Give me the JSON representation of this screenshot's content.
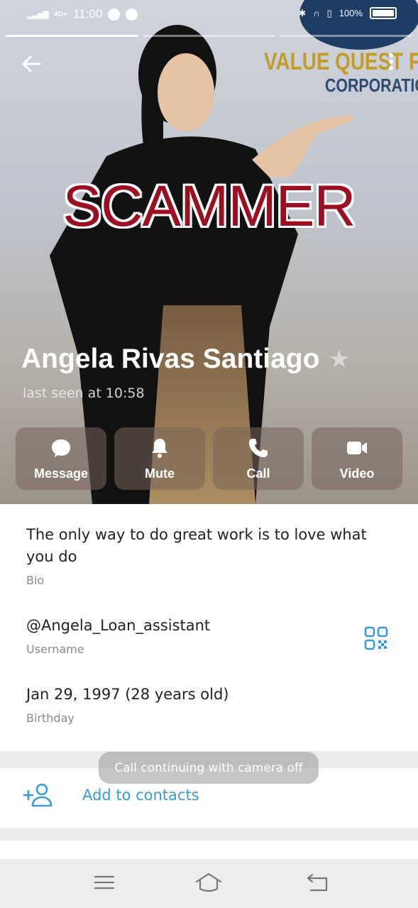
{
  "status_bar": {
    "network": "4G+",
    "time": "11:00",
    "battery": "100%"
  },
  "story_progress": {
    "segments": 3,
    "active": 1
  },
  "background_logo": {
    "line1": "VALUE QUEST FI",
    "line2": "CORPORATIO"
  },
  "overlay_text": "SCAMMER",
  "profile": {
    "name": "Angela Rivas Santiago",
    "last_seen": "last seen at 10:58"
  },
  "actions": [
    {
      "label": "Message",
      "icon": "message-icon"
    },
    {
      "label": "Mute",
      "icon": "bell-icon"
    },
    {
      "label": "Call",
      "icon": "phone-icon"
    },
    {
      "label": "Video",
      "icon": "video-icon"
    }
  ],
  "info": {
    "bio": "The only way to do great work is to love what you do",
    "bio_label": "Bio",
    "username": "@Angela_Loan_assistant",
    "username_label": "Username",
    "birthday": "Jan 29, 1997 (28 years old)",
    "birthday_label": "Birthday"
  },
  "toast": "Call continuing with camera off",
  "add_contacts": "Add to contacts",
  "colors": {
    "accent": "#3a9bd4",
    "scammer_text": "#9b1020",
    "logo_gold": "#c49a2a",
    "logo_navy": "#2b4a70"
  }
}
